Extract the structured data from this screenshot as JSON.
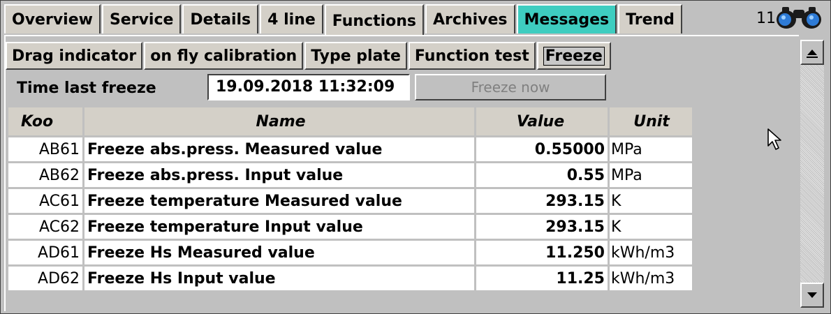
{
  "main_tabs": [
    {
      "label": "Overview"
    },
    {
      "label": "Service"
    },
    {
      "label": "Details"
    },
    {
      "label": "4 line"
    },
    {
      "label": "Functions",
      "active": true
    },
    {
      "label": "Archives"
    },
    {
      "label": "Messages",
      "highlight": "#3ecdc0"
    },
    {
      "label": "Trend"
    }
  ],
  "clock": "11:",
  "sub_tabs": [
    {
      "label": "Drag indicator"
    },
    {
      "label": "on fly calibration"
    },
    {
      "label": "Type plate"
    },
    {
      "label": "Function test"
    },
    {
      "label": "Freeze",
      "active": true
    }
  ],
  "freeze": {
    "time_label": "Time last freeze",
    "time_value": "19.09.2018 11:32:09",
    "button_label": "Freeze now"
  },
  "table": {
    "headers": {
      "koo": "Koo",
      "name": "Name",
      "value": "Value",
      "unit": "Unit"
    },
    "rows": [
      {
        "koo": "AB61",
        "name": "Freeze abs.press. Measured value",
        "value": "0.55000",
        "unit": "MPa"
      },
      {
        "koo": "AB62",
        "name": "Freeze abs.press. Input value",
        "value": "0.55",
        "unit": "MPa"
      },
      {
        "koo": "AC61",
        "name": "Freeze temperature Measured value",
        "value": "293.15",
        "unit": "K"
      },
      {
        "koo": "AC62",
        "name": "Freeze temperature Input value",
        "value": "293.15",
        "unit": "K"
      },
      {
        "koo": "AD61",
        "name": "Freeze Hs Measured value",
        "value": "11.250",
        "unit": "kWh/m3"
      },
      {
        "koo": "AD62",
        "name": "Freeze Hs Input value",
        "value": "11.25",
        "unit": "kWh/m3"
      }
    ]
  },
  "icons": {
    "binoculars": "binoculars-icon",
    "scroll_up": "arrow-up-icon",
    "scroll_down": "arrow-down-icon",
    "cursor": "mouse-pointer-icon"
  }
}
